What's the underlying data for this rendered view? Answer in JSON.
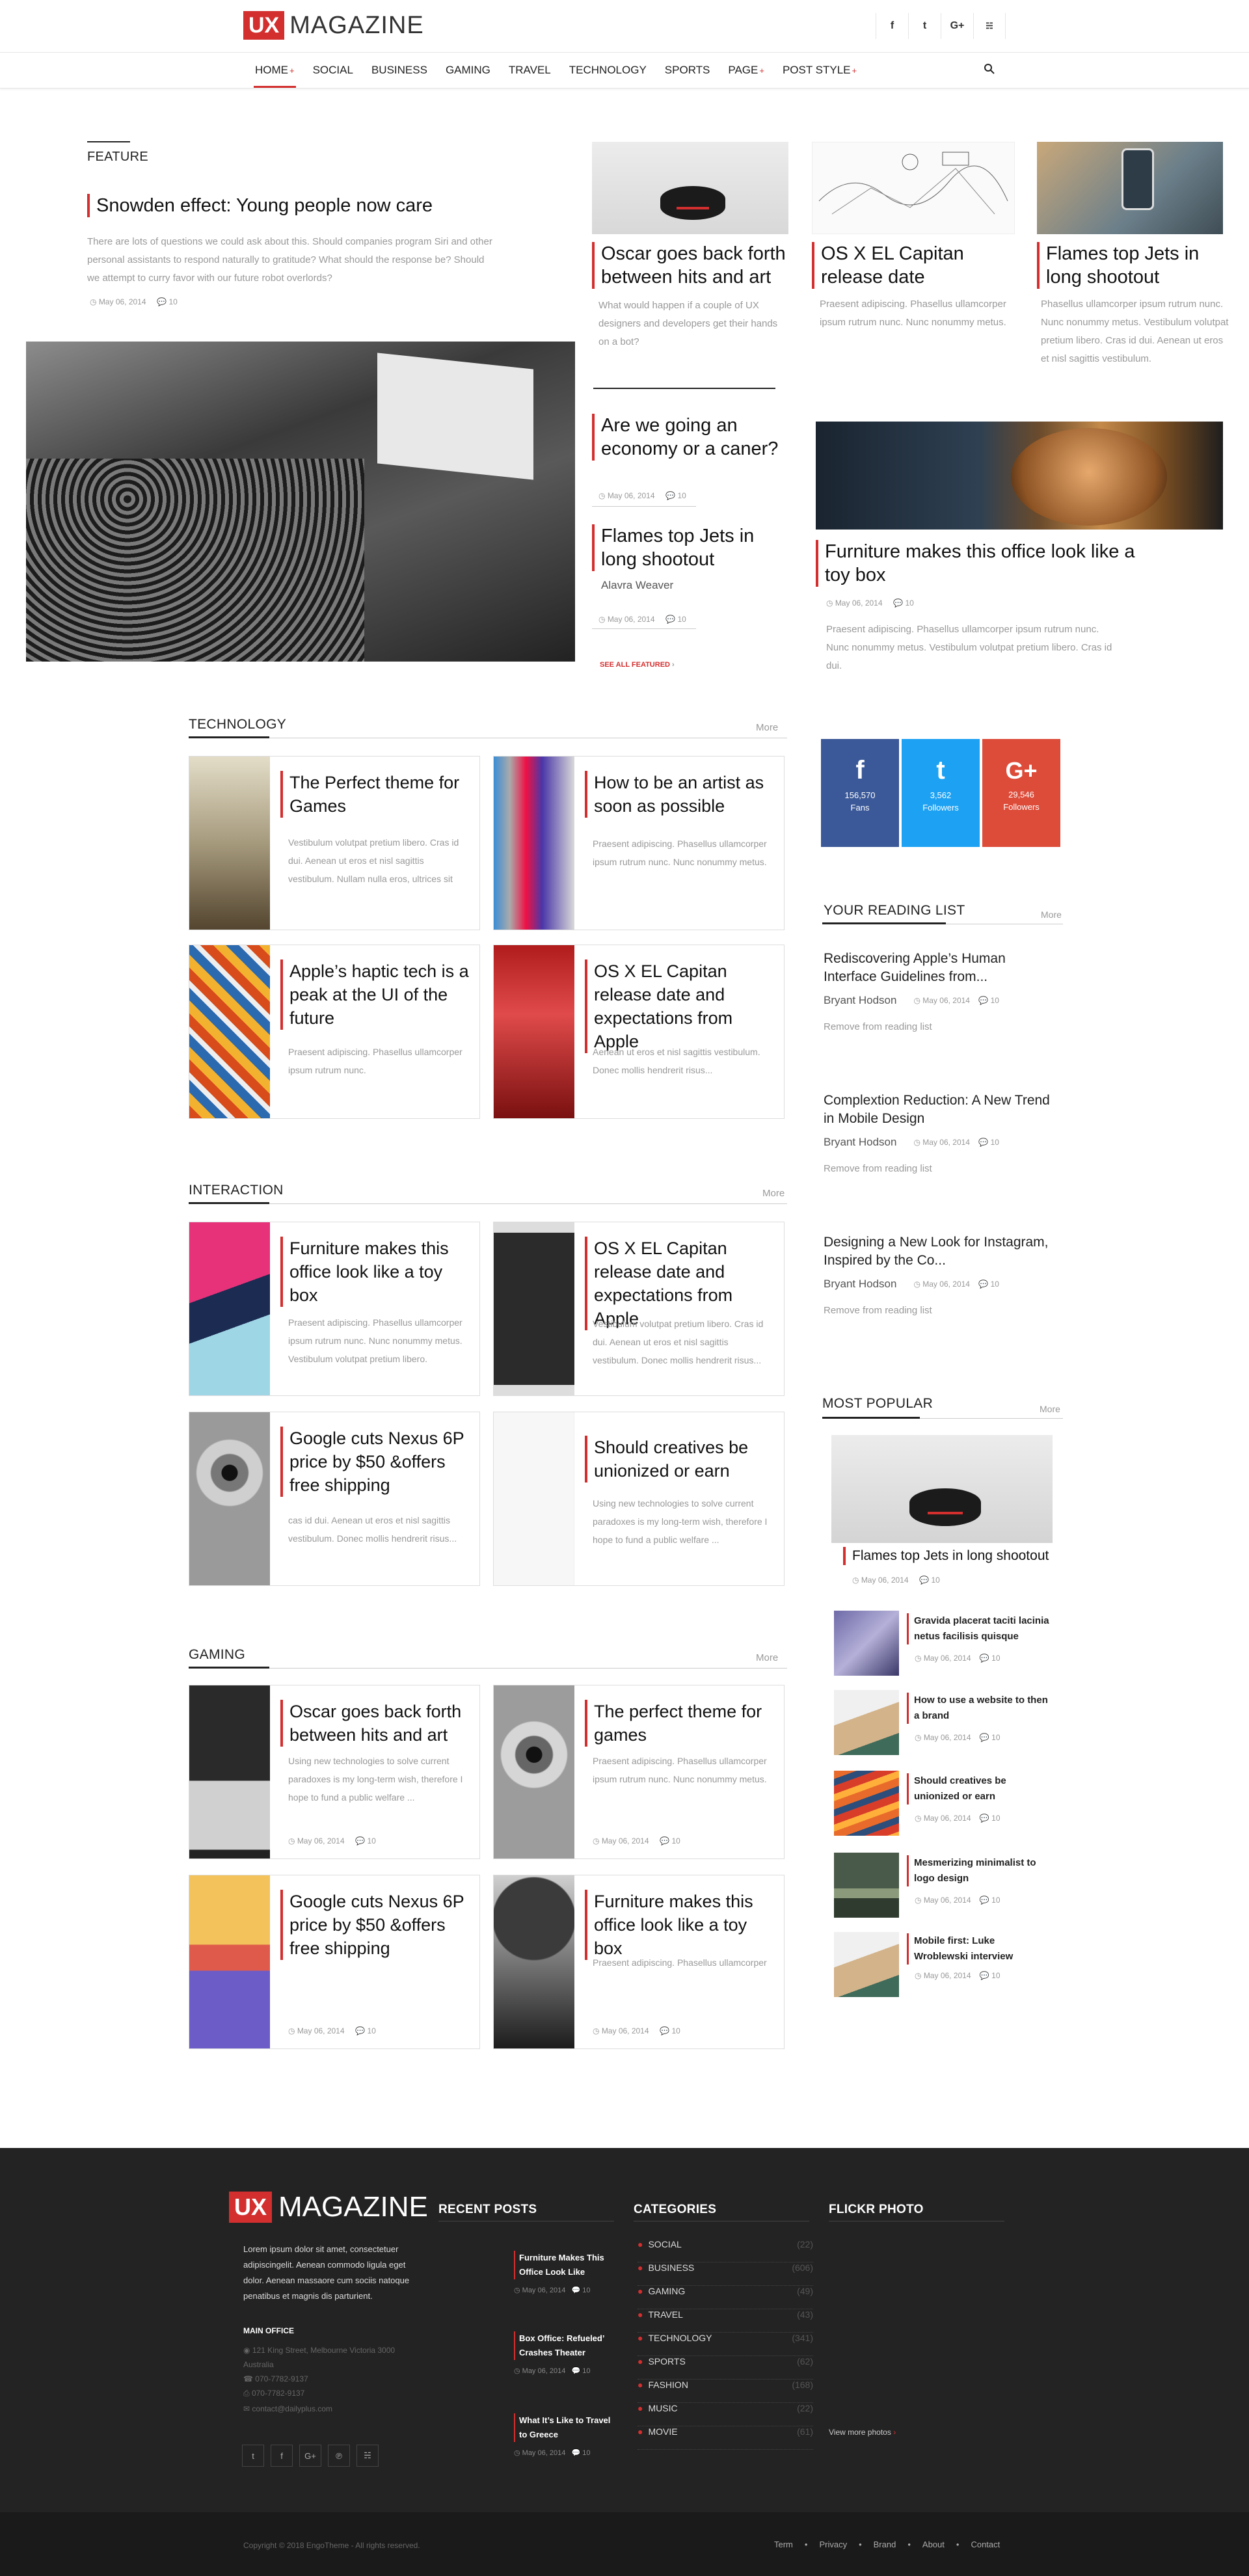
{
  "header": {
    "logo_ux": "UX",
    "logo_magazine": "MAGAZINE",
    "social": [
      "f",
      "t",
      "G+",
      "rss"
    ]
  },
  "nav": {
    "items": [
      "HOME",
      "SOCIAL",
      "BUSINESS",
      "GAMING",
      "TRAVEL",
      "TECHNOLOGY",
      "SPORTS",
      "PAGE",
      "POST STYLE"
    ],
    "plus": "+"
  },
  "featured": {
    "label": "FEATURE",
    "main": {
      "title": "Snowden effect: Young people now care",
      "excerpt": "There are lots of questions we could ask about this. Should companies program Siri and other personal assistants to respond naturally to gratitude? What should the response be? Should we attempt to curry favor with our future robot overlords?",
      "date": "May 06, 2014",
      "comments": "10"
    },
    "col2": [
      {
        "title": "Oscar goes back forth between hits and art",
        "excerpt": "What would happen if a couple of UX designers and developers get their hands on a bot?"
      },
      {
        "title": "Are we going an economy or a caner?",
        "date": "May 06, 2014",
        "comments": "10"
      },
      {
        "title": "Flames top Jets in long shootout",
        "author": "Alavra Weaver",
        "date": "May 06, 2014",
        "comments": "10"
      }
    ],
    "see_all": "SEE ALL FEATURED",
    "col3a": {
      "title": "OS X EL Capitan release date",
      "excerpt": "Praesent adipiscing. Phasellus ullamcorper ipsum rutrum nunc. Nunc nonummy metus."
    },
    "col3b": {
      "title": "Flames top Jets in long shootout",
      "excerpt": "Phasellus ullamcorper ipsum rutrum nunc. Nunc nonummy metus. Vestibulum volutpat pretium libero. Cras id dui. Aenean ut eros et nisl sagittis vestibulum."
    },
    "col3c": {
      "title": "Furniture makes this office look like a toy box",
      "date": "May 06, 2014",
      "comments": "10",
      "excerpt": "Praesent adipiscing. Phasellus ullamcorper ipsum rutrum nunc. Nunc nonummy metus. Vestibulum volutpat pretium libero. Cras id dui."
    }
  },
  "technology": {
    "title": "TECHNOLOGY",
    "more": "More",
    "cards": [
      {
        "title": "The Perfect theme for Games",
        "excerpt": "Vestibulum volutpat pretium libero. Cras id dui. Aenean ut eros et nisl sagittis vestibulum. Nullam nulla eros, ultrices sit"
      },
      {
        "title": "How to be an artist as soon as possible",
        "excerpt": "Praesent adipiscing. Phasellus ullamcorper ipsum rutrum nunc. Nunc nonummy metus."
      },
      {
        "title": "Apple’s haptic tech is a peak at the UI of the future",
        "excerpt": "Praesent adipiscing. Phasellus ullamcorper ipsum rutrum nunc."
      },
      {
        "title": "OS X EL Capitan release date and expectations from Apple",
        "excerpt": "Aenean ut eros et nisl sagittis vestibulum. Donec mollis hendrerit risus..."
      }
    ]
  },
  "interaction": {
    "title": "INTERACTION",
    "more": "More",
    "cards": [
      {
        "title": "Furniture makes this office look like a toy box",
        "excerpt": "Praesent adipiscing. Phasellus ullamcorper ipsum rutrum nunc. Nunc nonummy metus. Vestibulum volutpat pretium libero."
      },
      {
        "title": "OS X EL Capitan release date and expectations from Apple",
        "excerpt": "Vestibulum volutpat pretium libero. Cras id dui. Aenean ut eros et nisl sagittis vestibulum. Donec mollis hendrerit risus..."
      },
      {
        "title": "Google cuts Nexus 6P price by $50 &offers free shipping",
        "excerpt": "cas id dui. Aenean ut eros et nisl sagittis vestibulum. Donec mollis hendrerit risus..."
      },
      {
        "title": "Should creatives be unionized or earn",
        "excerpt": "Using new technologies to solve current paradoxes is my long-term wish, therefore I hope to fund a public welfare ..."
      }
    ]
  },
  "gaming": {
    "title": "GAMING",
    "more": "More",
    "cards": [
      {
        "title": "Oscar goes back forth between hits and art",
        "excerpt": "Using new technologies to solve current paradoxes is my long-term wish, therefore I hope to fund a public welfare ...",
        "date": "May 06, 2014",
        "comments": "10"
      },
      {
        "title": "The perfect theme for games",
        "excerpt": "Praesent adipiscing. Phasellus ullamcorper ipsum rutrum nunc. Nunc nonummy metus.",
        "date": "May 06, 2014",
        "comments": "10"
      },
      {
        "title": "Google cuts Nexus 6P price by $50 &offers free shipping",
        "excerpt": "",
        "date": "May 06, 2014",
        "comments": "10"
      },
      {
        "title": "Furniture makes this office look like a toy box",
        "excerpt": "Praesent adipiscing. Phasellus ullamcorper",
        "date": "May 06, 2014",
        "comments": "10"
      }
    ]
  },
  "sidebar": {
    "social": [
      {
        "icon": "f",
        "count": "156,570",
        "label": "Fans",
        "color": "#3b5998"
      },
      {
        "icon": "t",
        "count": "3,562",
        "label": "Followers",
        "color": "#1da1f2"
      },
      {
        "icon": "G+",
        "count": "29,546",
        "label": "Followers",
        "color": "#dd4b39"
      }
    ],
    "reading_title": "YOUR READING LIST",
    "reading_more": "More",
    "reading": [
      {
        "title": "Rediscovering Apple’s Human Interface Guidelines from...",
        "author": "Bryant Hodson",
        "date": "May 06, 2014",
        "comments": "10",
        "remove": "Remove from reading list"
      },
      {
        "title": "Complextion Reduction: A New Trend in Mobile Design",
        "author": "Bryant Hodson",
        "date": "May 06, 2014",
        "comments": "10",
        "remove": "Remove from reading list"
      },
      {
        "title": "Designing a New Look for Instagram, Inspired by the Co...",
        "author": "Bryant Hodson",
        "date": "May 06, 2014",
        "comments": "10",
        "remove": "Remove from reading list"
      }
    ],
    "popular_title": "MOST POPULAR",
    "popular_more": "More",
    "popular_main": {
      "title": "Flames top Jets in long shootout",
      "date": "May 06, 2014",
      "comments": "10"
    },
    "popular": [
      {
        "title": "Gravida placerat taciti lacinia netus facilisis quisque",
        "date": "May 06, 2014",
        "comments": "10"
      },
      {
        "title": "How to use a website to then a brand",
        "date": "May 06, 2014",
        "comments": "10"
      },
      {
        "title": "Should creatives be unionized or earn",
        "date": "May 06, 2014",
        "comments": "10"
      },
      {
        "title": "Mesmerizing minimalist to logo design",
        "date": "May 06, 2014",
        "comments": "10"
      },
      {
        "title": "Mobile first: Luke Wroblewski interview",
        "date": "May 06, 2014",
        "comments": "10"
      }
    ]
  },
  "footer": {
    "logo_ux": "UX",
    "logo_magazine": "MAGAZINE",
    "about": "Lorem ipsum dolor sit amet, consectetuer adipiscingelit. Aenean commodo ligula eget dolor. Aenean massaore cum sociis natoque penatibus et magnis dis parturient.",
    "office_label": "MAIN OFFICE",
    "address": "121 King Street, Melbourne Victoria 3000 Australia",
    "phone1": "070-7782-9137",
    "phone2": "070-7782-9137",
    "email": "contact@dailyplus.com",
    "recent_title": "RECENT POSTS",
    "recent": [
      {
        "title": "Furniture Makes This Office Look Like",
        "date": "May 06, 2014",
        "comments": "10"
      },
      {
        "title": "Box Office: Refueled’ Crashes Theater",
        "date": "May 06, 2014",
        "comments": "10"
      },
      {
        "title": "What It’s Like to Travel to Greece",
        "date": "May 06, 2014",
        "comments": "10"
      }
    ],
    "cat_title": "CATEGORIES",
    "categories": [
      {
        "name": "SOCIAL",
        "count": "(22)"
      },
      {
        "name": "BUSINESS",
        "count": "(606)"
      },
      {
        "name": "GAMING",
        "count": "(49)"
      },
      {
        "name": "TRAVEL",
        "count": "(43)"
      },
      {
        "name": "TECHNOLOGY",
        "count": "(341)"
      },
      {
        "name": "SPORTS",
        "count": "(62)"
      },
      {
        "name": "FASHION",
        "count": "(168)"
      },
      {
        "name": "MUSIC",
        "count": "(22)"
      },
      {
        "name": "MOVIE",
        "count": "(61)"
      }
    ],
    "flickr_title": "FLICKR PHOTO",
    "flickr_more": "View more photos",
    "copyright": "Copyright © 2018 EngoTheme - All rights reserved.",
    "links": [
      "Term",
      "Privacy",
      "Brand",
      "About",
      "Contact"
    ]
  }
}
